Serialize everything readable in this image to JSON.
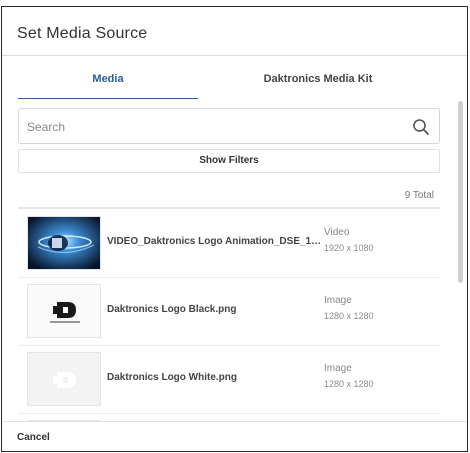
{
  "dialog": {
    "title": "Set Media Source",
    "tabs": [
      {
        "label": "Media",
        "active": true
      },
      {
        "label": "Daktronics Media Kit",
        "active": false
      }
    ],
    "search": {
      "placeholder": "Search",
      "value": ""
    },
    "filters_label": "Show Filters",
    "total_label": "9 Total",
    "items": [
      {
        "name": "VIDEO_Daktronics Logo Animation_DSE_1920x1…",
        "type": "Video",
        "dims": "1920 x 1080",
        "thumb": "video-thumbnail"
      },
      {
        "name": "Daktronics Logo Black.png",
        "type": "Image",
        "dims": "1280 x 1280",
        "thumb": "logo-black-thumbnail"
      },
      {
        "name": "Daktronics Logo White.png",
        "type": "Image",
        "dims": "1280 x 1280",
        "thumb": "logo-white-thumbnail"
      }
    ],
    "cancel_label": "Cancel"
  },
  "colors": {
    "accent": "#2a5d9a",
    "border": "#2b2b2b",
    "muted_text": "#888888"
  },
  "icons": [
    "search-icon"
  ]
}
